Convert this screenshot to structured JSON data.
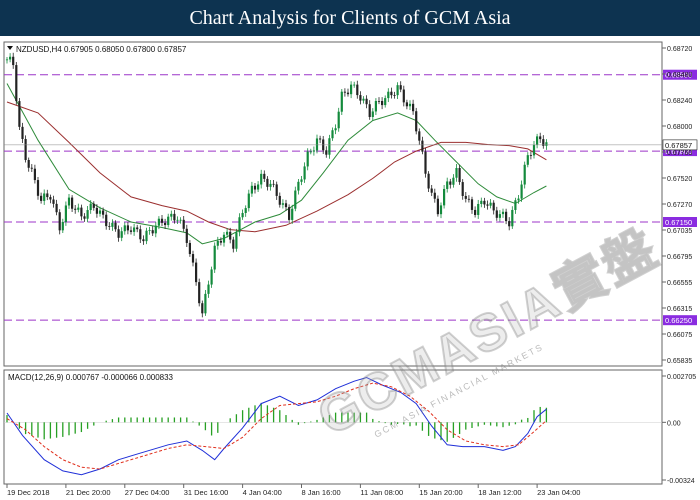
{
  "header": {
    "title": "Chart Analysis for Clients of GCM Asia"
  },
  "price_info": "NZDUSD,H4  0.67905 0.68050 0.67800 0.67857",
  "macd_info": "MACD(12,26,9) 0.000767 -0.000066 0.000833",
  "watermark": {
    "main": "GCMASIA實盤",
    "sub": "GCM ASIA FINANCIAL MARKETS"
  },
  "colors": {
    "bull": "#138a3c",
    "bear": "#222222",
    "ma_fast": "#2e8b3a",
    "ma_slow": "#9b2f2f",
    "level": "#9c35c8",
    "badge": "#8a2ce0",
    "macd_main": "#1f2fd8",
    "macd_signal": "#e0301e",
    "macd_hist": "#27a024"
  },
  "chart_data": [
    {
      "type": "candlestick",
      "symbol": "NZDUSD,H4",
      "ylim": [
        0.6583,
        0.688
      ],
      "y_ticks": [
        "0.68720",
        "0.68480",
        "0.68240",
        "0.68000",
        "0.67760",
        "0.67520",
        "0.67270",
        "0.67035",
        "0.66795",
        "0.66555",
        "0.66315",
        "0.66075",
        "0.65835"
      ],
      "x_ticks": [
        {
          "label": "19 Dec 2018",
          "i": 0
        },
        {
          "label": "21 Dec 20:00",
          "i": 19
        },
        {
          "label": "27 Dec 04:00",
          "i": 38
        },
        {
          "label": "31 Dec 16:00",
          "i": 57
        },
        {
          "label": "4 Jan 04:00",
          "i": 76
        },
        {
          "label": "8 Jan 16:00",
          "i": 95
        },
        {
          "label": "11 Jan 08:00",
          "i": 114
        },
        {
          "label": "15 Jan 20:00",
          "i": 133
        },
        {
          "label": "18 Jan 12:00",
          "i": 152
        },
        {
          "label": "23 Jan 04:00",
          "i": 171
        }
      ],
      "levels": [
        {
          "label": "0.68500",
          "value": 0.685
        },
        {
          "label": "0.67800",
          "value": 0.678
        },
        {
          "label": "0.67150",
          "value": 0.6715
        },
        {
          "label": "0.66250",
          "value": 0.6625
        }
      ],
      "current_price": {
        "label": "0.67857",
        "value": 0.67857
      },
      "price_path": [
        [
          0,
          0.6864
        ],
        [
          2,
          0.686
        ],
        [
          4,
          0.68
        ],
        [
          6,
          0.6775
        ],
        [
          8,
          0.676
        ],
        [
          11,
          0.6735
        ],
        [
          14,
          0.674
        ],
        [
          17,
          0.671
        ],
        [
          20,
          0.6735
        ],
        [
          24,
          0.672
        ],
        [
          28,
          0.673
        ],
        [
          32,
          0.6715
        ],
        [
          36,
          0.6705
        ],
        [
          40,
          0.671
        ],
        [
          44,
          0.67
        ],
        [
          48,
          0.6712
        ],
        [
          52,
          0.6718
        ],
        [
          55,
          0.672
        ],
        [
          58,
          0.67
        ],
        [
          61,
          0.666
        ],
        [
          63,
          0.663
        ],
        [
          65,
          0.666
        ],
        [
          67,
          0.669
        ],
        [
          70,
          0.6705
        ],
        [
          73,
          0.6695
        ],
        [
          76,
          0.6725
        ],
        [
          79,
          0.6745
        ],
        [
          82,
          0.6755
        ],
        [
          85,
          0.675
        ],
        [
          88,
          0.6735
        ],
        [
          91,
          0.672
        ],
        [
          94,
          0.675
        ],
        [
          97,
          0.6775
        ],
        [
          100,
          0.679
        ],
        [
          103,
          0.678
        ],
        [
          106,
          0.6805
        ],
        [
          108,
          0.683
        ],
        [
          111,
          0.684
        ],
        [
          114,
          0.683
        ],
        [
          117,
          0.6815
        ],
        [
          120,
          0.6825
        ],
        [
          123,
          0.683
        ],
        [
          126,
          0.6838
        ],
        [
          128,
          0.6828
        ],
        [
          131,
          0.6815
        ],
        [
          133,
          0.679
        ],
        [
          135,
          0.676
        ],
        [
          137,
          0.674
        ],
        [
          139,
          0.6725
        ],
        [
          142,
          0.675
        ],
        [
          145,
          0.676
        ],
        [
          148,
          0.6735
        ],
        [
          151,
          0.6725
        ],
        [
          154,
          0.6735
        ],
        [
          157,
          0.6725
        ],
        [
          160,
          0.672
        ],
        [
          162,
          0.6715
        ],
        [
          165,
          0.674
        ],
        [
          168,
          0.6775
        ],
        [
          170,
          0.6786
        ],
        [
          172,
          0.6792
        ],
        [
          174,
          0.6786
        ]
      ],
      "series": [
        {
          "name": "MA fast",
          "points": [
            [
              0,
              0.6842
            ],
            [
              10,
              0.679
            ],
            [
              20,
              0.6745
            ],
            [
              30,
              0.6728
            ],
            [
              40,
              0.6715
            ],
            [
              50,
              0.671
            ],
            [
              58,
              0.6705
            ],
            [
              63,
              0.6695
            ],
            [
              70,
              0.67
            ],
            [
              80,
              0.6715
            ],
            [
              88,
              0.6722
            ],
            [
              95,
              0.6735
            ],
            [
              102,
              0.676
            ],
            [
              110,
              0.679
            ],
            [
              118,
              0.6808
            ],
            [
              126,
              0.6815
            ],
            [
              132,
              0.6808
            ],
            [
              138,
              0.679
            ],
            [
              145,
              0.677
            ],
            [
              152,
              0.675
            ],
            [
              158,
              0.6738
            ],
            [
              164,
              0.6732
            ],
            [
              170,
              0.6742
            ],
            [
              174,
              0.6748
            ]
          ]
        },
        {
          "name": "MA slow",
          "points": [
            [
              0,
              0.6825
            ],
            [
              10,
              0.6815
            ],
            [
              20,
              0.6788
            ],
            [
              30,
              0.676
            ],
            [
              40,
              0.6738
            ],
            [
              50,
              0.673
            ],
            [
              58,
              0.6725
            ],
            [
              65,
              0.6715
            ],
            [
              72,
              0.6708
            ],
            [
              80,
              0.6706
            ],
            [
              90,
              0.6712
            ],
            [
              100,
              0.6725
            ],
            [
              110,
              0.674
            ],
            [
              118,
              0.6755
            ],
            [
              125,
              0.677
            ],
            [
              132,
              0.678
            ],
            [
              140,
              0.6788
            ],
            [
              148,
              0.6788
            ],
            [
              155,
              0.6786
            ],
            [
              162,
              0.6785
            ],
            [
              168,
              0.6782
            ],
            [
              174,
              0.6772
            ]
          ]
        }
      ]
    },
    {
      "type": "line",
      "name": "MACD(12,26,9)",
      "ylim": [
        -0.0033,
        0.0028
      ],
      "y_ticks": [
        {
          "label": "0.002705",
          "value": 0.002705
        },
        {
          "label": "0.00",
          "value": 0
        },
        {
          "label": "-0.00324",
          "value": -0.00324
        }
      ],
      "series": [
        {
          "name": "MACD",
          "points": [
            [
              0,
              0.0005
            ],
            [
              5,
              -0.0007
            ],
            [
              12,
              -0.002
            ],
            [
              18,
              -0.0026
            ],
            [
              24,
              -0.0028
            ],
            [
              30,
              -0.0025
            ],
            [
              36,
              -0.002
            ],
            [
              44,
              -0.0016
            ],
            [
              52,
              -0.0012
            ],
            [
              58,
              -0.001
            ],
            [
              63,
              -0.0015
            ],
            [
              67,
              -0.002
            ],
            [
              70,
              -0.0014
            ],
            [
              76,
              -0.0003
            ],
            [
              82,
              0.001
            ],
            [
              88,
              0.0014
            ],
            [
              94,
              0.0009
            ],
            [
              100,
              0.0012
            ],
            [
              106,
              0.0018
            ],
            [
              112,
              0.0022
            ],
            [
              116,
              0.0024
            ],
            [
              121,
              0.002
            ],
            [
              127,
              0.0016
            ],
            [
              132,
              0.001
            ],
            [
              137,
              -0.0002
            ],
            [
              142,
              -0.0012
            ],
            [
              147,
              -0.0013
            ],
            [
              154,
              -0.0013
            ],
            [
              160,
              -0.0015
            ],
            [
              164,
              -0.0013
            ],
            [
              168,
              -0.0006
            ],
            [
              171,
              0.0003
            ],
            [
              174,
              0.0007
            ]
          ]
        },
        {
          "name": "Signal",
          "points": [
            [
              0,
              0.0002
            ],
            [
              6,
              -0.0004
            ],
            [
              12,
              -0.0013
            ],
            [
              18,
              -0.002
            ],
            [
              24,
              -0.0024
            ],
            [
              30,
              -0.0025
            ],
            [
              36,
              -0.0022
            ],
            [
              44,
              -0.0018
            ],
            [
              52,
              -0.0014
            ],
            [
              58,
              -0.0012
            ],
            [
              64,
              -0.0013
            ],
            [
              70,
              -0.0014
            ],
            [
              76,
              -0.0008
            ],
            [
              82,
              0.0002
            ],
            [
              88,
              0.0009
            ],
            [
              94,
              0.001
            ],
            [
              100,
              0.0011
            ],
            [
              106,
              0.0014
            ],
            [
              112,
              0.0018
            ],
            [
              118,
              0.0021
            ],
            [
              124,
              0.0019
            ],
            [
              130,
              0.0014
            ],
            [
              136,
              0.0006
            ],
            [
              142,
              -0.0004
            ],
            [
              148,
              -0.001
            ],
            [
              154,
              -0.0012
            ],
            [
              160,
              -0.0013
            ],
            [
              165,
              -0.0012
            ],
            [
              170,
              -0.0005
            ],
            [
              174,
              0.0001
            ]
          ]
        }
      ]
    }
  ]
}
